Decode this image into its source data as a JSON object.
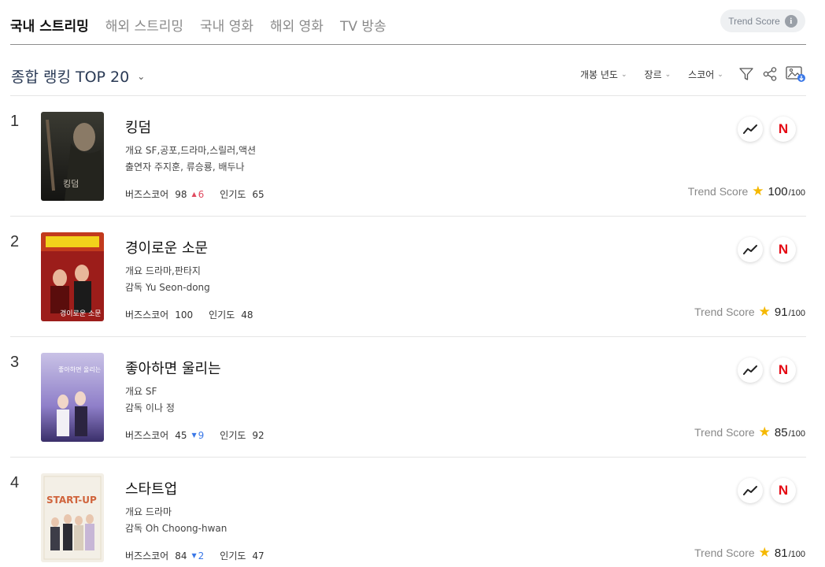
{
  "nav": {
    "tabs": [
      "국내 스트리밍",
      "해외 스트리밍",
      "국내 영화",
      "해외 영화",
      "TV 방송"
    ],
    "active_index": 0
  },
  "trend_pill": {
    "label": "Trend Score",
    "icon": "info-icon"
  },
  "ranking": {
    "title": "종합 랭킹 TOP 20",
    "filters": [
      "개봉 년도",
      "장르",
      "스코어"
    ],
    "tools": [
      "filter-icon",
      "share-icon",
      "image-download-icon"
    ]
  },
  "labels": {
    "genre_prefix": "개요",
    "buzz": "버즈스코어",
    "popularity": "인기도",
    "trend_score": "Trend Score",
    "max": "/100",
    "netflix": "N"
  },
  "colors": {
    "up": "#e04a5f",
    "down": "#3b78e7",
    "star": "#f5b800",
    "netflix": "#e50914"
  },
  "items": [
    {
      "rank": "1",
      "title": "킹덤",
      "genre": "SF,공포,드라마,스릴러,액션",
      "people_label": "출연자",
      "people": "주지훈, 류승룡, 배두나",
      "buzz": "98",
      "delta": "6",
      "delta_dir": "up",
      "popularity": "65",
      "trend": "100",
      "poster_caption": "킹덤"
    },
    {
      "rank": "2",
      "title": "경이로운 소문",
      "genre": "드라마,판타지",
      "people_label": "감독",
      "people": "Yu Seon-dong",
      "buzz": "100",
      "delta": "",
      "delta_dir": "none",
      "popularity": "48",
      "trend": "91",
      "poster_caption": "경이로운 소문"
    },
    {
      "rank": "3",
      "title": "좋아하면 울리는",
      "genre": "SF",
      "people_label": "감독",
      "people": "이나 정",
      "buzz": "45",
      "delta": "9",
      "delta_dir": "down",
      "popularity": "92",
      "trend": "85",
      "poster_caption": "좋아하면 울리는"
    },
    {
      "rank": "4",
      "title": "스타트업",
      "genre": "드라마",
      "people_label": "감독",
      "people": "Oh Choong-hwan",
      "buzz": "84",
      "delta": "2",
      "delta_dir": "down",
      "popularity": "47",
      "trend": "81",
      "poster_caption": "START-UP"
    }
  ]
}
